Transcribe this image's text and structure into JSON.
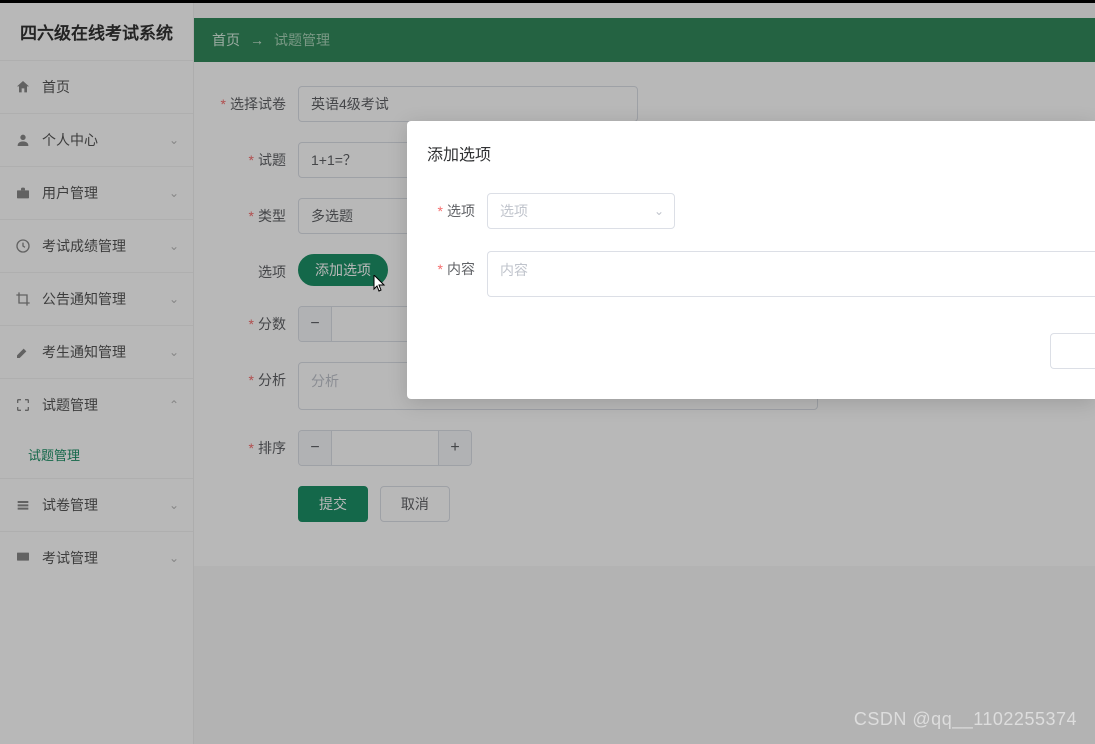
{
  "app": {
    "title": "四六级在线考试系统"
  },
  "sidebar": {
    "items": [
      {
        "label": "首页"
      },
      {
        "label": "个人中心"
      },
      {
        "label": "用户管理"
      },
      {
        "label": "考试成绩管理"
      },
      {
        "label": "公告通知管理"
      },
      {
        "label": "考生通知管理"
      },
      {
        "label": "试题管理",
        "sub": [
          {
            "label": "试题管理"
          }
        ]
      },
      {
        "label": "试卷管理"
      },
      {
        "label": "考试管理"
      }
    ]
  },
  "breadcrumb": {
    "home": "首页",
    "current": "试题管理",
    "sep": "→"
  },
  "form": {
    "paper": {
      "label": "选择试卷",
      "value": "英语4级考试"
    },
    "question": {
      "label": "试题",
      "value": "1+1=？"
    },
    "type": {
      "label": "类型",
      "value": "多选题"
    },
    "options": {
      "label": "选项",
      "add": "添加选项"
    },
    "score": {
      "label": "分数"
    },
    "analysis": {
      "label": "分析",
      "placeholder": "分析"
    },
    "sort": {
      "label": "排序"
    },
    "submit": "提交",
    "cancel": "取消"
  },
  "dialog": {
    "title": "添加选项",
    "option": {
      "label": "选项",
      "placeholder": "选项"
    },
    "content": {
      "label": "内容",
      "placeholder": "内容"
    }
  },
  "watermark": "CSDN @qq__1102255374"
}
